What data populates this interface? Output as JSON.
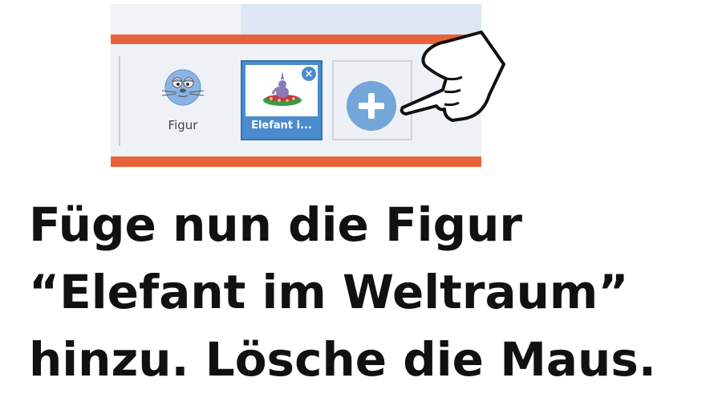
{
  "sprites": {
    "mouse": {
      "label": "Figur",
      "icon": "mouse-sprite-icon"
    },
    "elefant": {
      "label": "Elefant i...",
      "icon": "elephant-ufo-sprite-icon",
      "close_icon": "close-icon",
      "close_glyph": "×",
      "selected": true
    }
  },
  "add_button": {
    "icon": "plus-icon"
  },
  "pointer": {
    "icon": "pointing-hand-icon"
  },
  "instruction": {
    "line1": "Füge nun die Figur",
    "line2": "“Elefant im Weltraum”",
    "line3": "hinzu. Lösche die Maus."
  },
  "colors": {
    "accent_bar": "#e8623c",
    "selected_tile": "#4a8ccc",
    "add_circle": "#74a6da"
  }
}
